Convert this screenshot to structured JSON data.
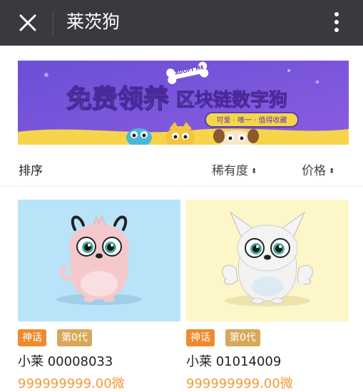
{
  "nav": {
    "title": "莱茨狗"
  },
  "banner": {
    "headline": "免费领养",
    "subheadline": "区块链数字狗",
    "tag": "ADOPT ME",
    "slogan": "可爱 · 唯一 · 值得收藏",
    "bg_color": "#7a55d8"
  },
  "sort": {
    "label": "排序",
    "rarity": "稀有度",
    "price": "价格"
  },
  "cards": [
    {
      "badge_type": "神话",
      "badge_gen": "第0代",
      "name": "小莱 00008033",
      "price": "999999999.00微",
      "bg": "#b9e3f8"
    },
    {
      "badge_type": "神话",
      "badge_gen": "第0代",
      "name": "小莱 01014009",
      "price": "999999999.00微",
      "bg": "#fdf6c8"
    }
  ],
  "colors": {
    "navbar": "#393a3f",
    "accent_orange": "#f39a3a",
    "myth_badge": "#f08a2e",
    "gen_badge": "#d8a85a"
  },
  "icons": {
    "close": "close-icon",
    "more": "more-vertical-icon",
    "sort": "sort-caret-icon"
  }
}
